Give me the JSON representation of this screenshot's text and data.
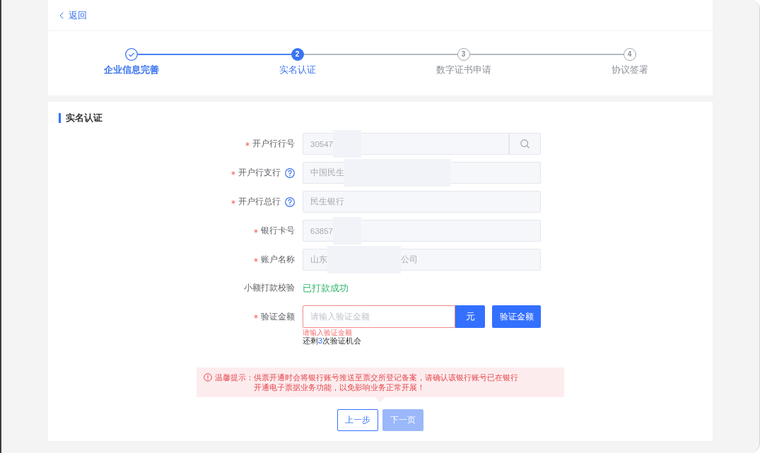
{
  "back_link": {
    "label": "返回"
  },
  "steps": [
    {
      "label": "企业信息完善",
      "completed": true,
      "selected": false
    },
    {
      "number": "2",
      "label": "实名认证",
      "completed": false,
      "selected": true
    },
    {
      "number": "3",
      "label": "数字证书申请",
      "completed": false,
      "selected": false
    },
    {
      "number": "4",
      "label": "协议签署",
      "completed": false,
      "selected": false
    }
  ],
  "form": {
    "title": "实名认证",
    "fields": [
      {
        "kind": "input",
        "label": "开户行行号",
        "required": true,
        "help": false,
        "value": "30547",
        "redacted": true,
        "disabled": true,
        "search_button": true
      },
      {
        "kind": "input",
        "label": "开户行支行",
        "required": true,
        "help": true,
        "value": "中国民生",
        "redacted": true,
        "disabled": true,
        "search_button": false
      },
      {
        "kind": "input",
        "label": "开户行总行",
        "required": true,
        "help": true,
        "value": "民生银行",
        "redacted": false,
        "disabled": true,
        "search_button": false
      },
      {
        "kind": "input",
        "label": "银行卡号",
        "required": true,
        "help": false,
        "value": "63857",
        "redacted": true,
        "disabled": true,
        "search_button": false
      },
      {
        "kind": "input",
        "label": "账户名称",
        "required": true,
        "help": false,
        "value": "山东",
        "redacted": true,
        "value_tail": "公司",
        "disabled": true,
        "search_button": false
      },
      {
        "kind": "status",
        "label": "小额打款校验",
        "required": false,
        "help": false,
        "value": "已打款成功"
      },
      {
        "kind": "amount",
        "label": "验证金额",
        "required": true,
        "help": false,
        "placeholder": "请输入验证金额",
        "disabled": false,
        "unit": "元",
        "action": "验证金额",
        "error": "请输入验证金额",
        "attempts": {
          "before": "还剩",
          "count": "3",
          "after": "次验证机会"
        }
      }
    ]
  },
  "notice": {
    "title": "温馨提示：",
    "message": "供票开通时会将银行账号推送至票交所登记备案，请确认该银行账号已在银行开通电子票据业务功能，以免影响业务正常开展！"
  },
  "buttons": [
    {
      "label": "上一步",
      "kind": "secondary",
      "disabled": false
    },
    {
      "label": "下一页",
      "kind": "primary",
      "disabled": true
    }
  ]
}
